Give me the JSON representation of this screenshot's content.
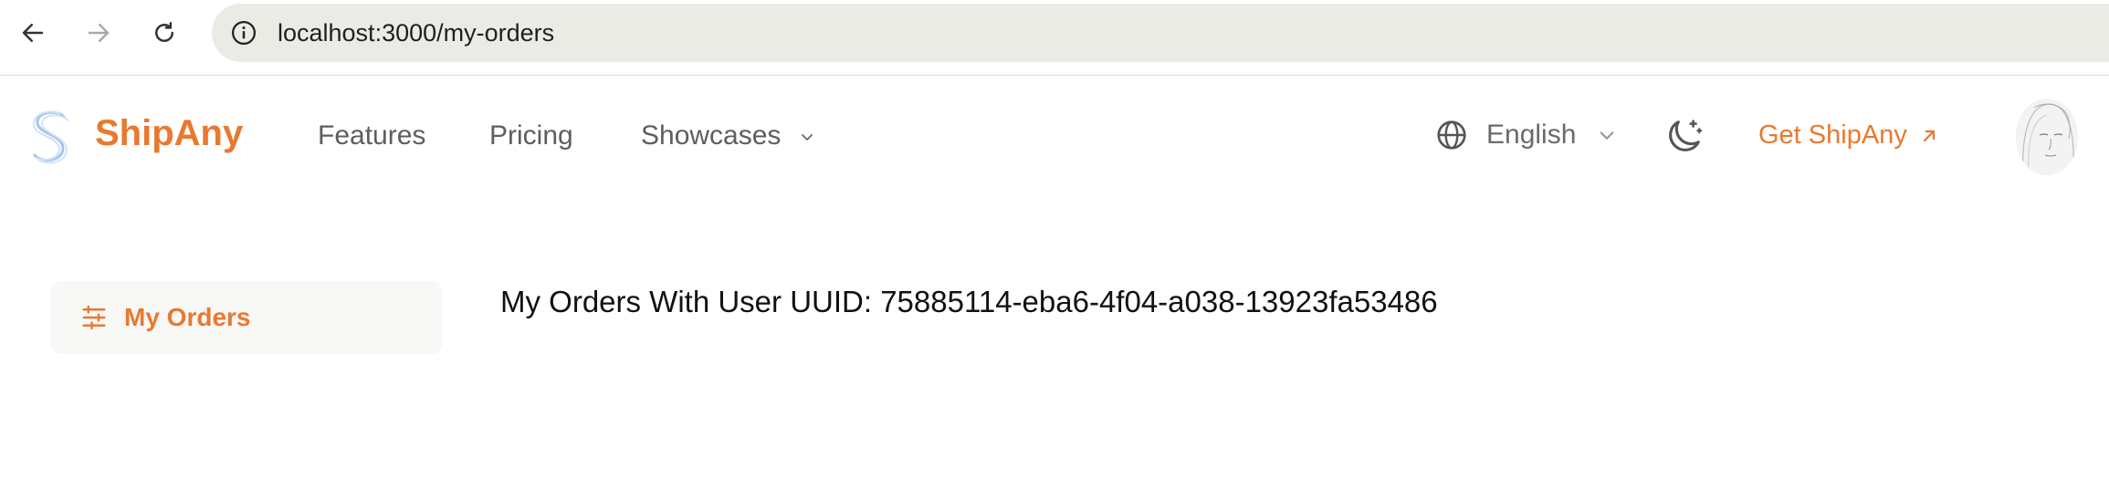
{
  "browser": {
    "url": "localhost:3000/my-orders"
  },
  "header": {
    "brand": "ShipAny",
    "nav": [
      "Features",
      "Pricing",
      "Showcases"
    ],
    "language": "English",
    "cta_label": "Get ShipAny"
  },
  "sidebar": {
    "items": [
      {
        "label": "My Orders",
        "icon": "menu-lines-icon"
      }
    ]
  },
  "main": {
    "title": "My Orders With User UUID: 75885114-eba6-4f04-a038-13923fa53486"
  },
  "colors": {
    "accent": "#e8792f",
    "url_bar": "#ebebe6",
    "sidebar_bg": "#f8f8f7"
  }
}
